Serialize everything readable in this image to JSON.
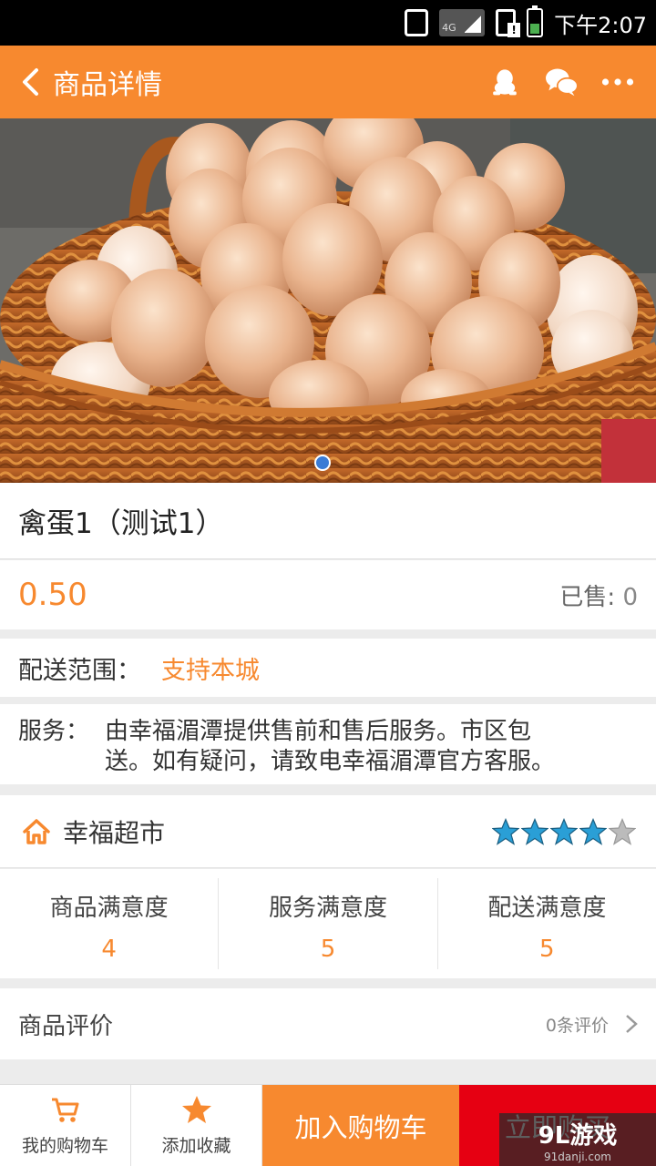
{
  "status_bar": {
    "time": "下午2:07",
    "network": "4G"
  },
  "app_bar": {
    "title": "商品详情"
  },
  "product": {
    "name": "禽蛋1（测试1）",
    "price": "0.50",
    "sold_label": "已售: ",
    "sold_count": "0",
    "delivery_label": "配送范围：",
    "delivery_value": "支持本城",
    "service_label": "服务：",
    "service_text": "由幸福湄潭提供售前和售后服务。市区包送。如有疑问，请致电幸福湄潭官方客服。",
    "image_page_count": 1
  },
  "store": {
    "name": "幸福超市",
    "rating_stars": 4,
    "rating_max": 5,
    "ratings": [
      {
        "label": "商品满意度",
        "value": "4"
      },
      {
        "label": "服务满意度",
        "value": "5"
      },
      {
        "label": "配送满意度",
        "value": "5"
      }
    ]
  },
  "reviews": {
    "label": "商品评价",
    "count": "0条评价"
  },
  "bottom_bar": {
    "cart_label": "我的购物车",
    "favorite_label": "添加收藏",
    "add_to_cart": "加入购物车",
    "buy_now": "立即购买"
  },
  "watermark": {
    "logo": "9L游戏",
    "url": "91danji.com"
  },
  "colors": {
    "accent": "#f7892f",
    "buy": "#e60012",
    "star": "#2a9fd6"
  },
  "icons": [
    "back-arrow-icon",
    "qq-icon",
    "wechat-icon",
    "more-icon",
    "home-icon",
    "star-icon",
    "cart-icon",
    "chevron-right-icon"
  ]
}
